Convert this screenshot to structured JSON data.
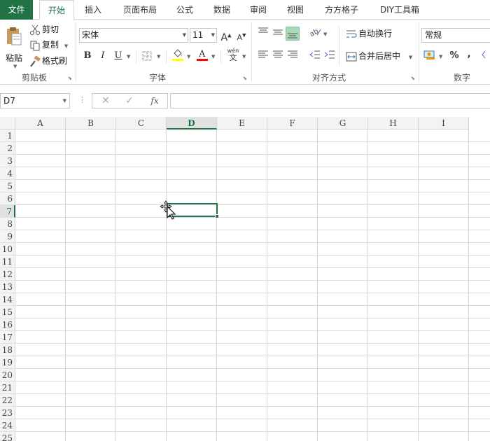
{
  "tabs": {
    "file": "文件",
    "home": "开始",
    "insert": "插入",
    "page_layout": "页面布局",
    "formulas": "公式",
    "data": "数据",
    "review": "审阅",
    "view": "视图",
    "fangfang": "方方格子",
    "diy": "DIY工具箱"
  },
  "ribbon": {
    "clipboard": {
      "paste": "粘贴",
      "cut": "剪切",
      "copy": "复制",
      "format_painter": "格式刷",
      "group_label": "剪贴板"
    },
    "font": {
      "font_name": "宋体",
      "font_size": "11",
      "bold": "B",
      "italic": "I",
      "underline": "U",
      "phonetic_top": "wén",
      "phonetic_bottom": "文",
      "group_label": "字体",
      "fill_color": "#ffff00",
      "font_color": "#ff0000"
    },
    "alignment": {
      "wrap_text": "自动换行",
      "merge_center": "合并后居中",
      "group_label": "对齐方式"
    },
    "number": {
      "format": "常规",
      "percent": "%",
      "comma": ",",
      "group_label": "数字"
    }
  },
  "formula_bar": {
    "name_box": "D7",
    "fx": "fx",
    "cancel": "✕",
    "enter": "✓",
    "value": ""
  },
  "sheet": {
    "columns": [
      "A",
      "B",
      "C",
      "D",
      "E",
      "F",
      "G",
      "H",
      "I"
    ],
    "rows": [
      "1",
      "2",
      "3",
      "4",
      "5",
      "6",
      "7",
      "8",
      "9",
      "10",
      "11",
      "12",
      "13",
      "14",
      "15",
      "16",
      "17",
      "18",
      "19",
      "20",
      "21",
      "22",
      "23",
      "24",
      "25"
    ],
    "active_column": "D",
    "active_row": "7",
    "accent": "#217346"
  }
}
